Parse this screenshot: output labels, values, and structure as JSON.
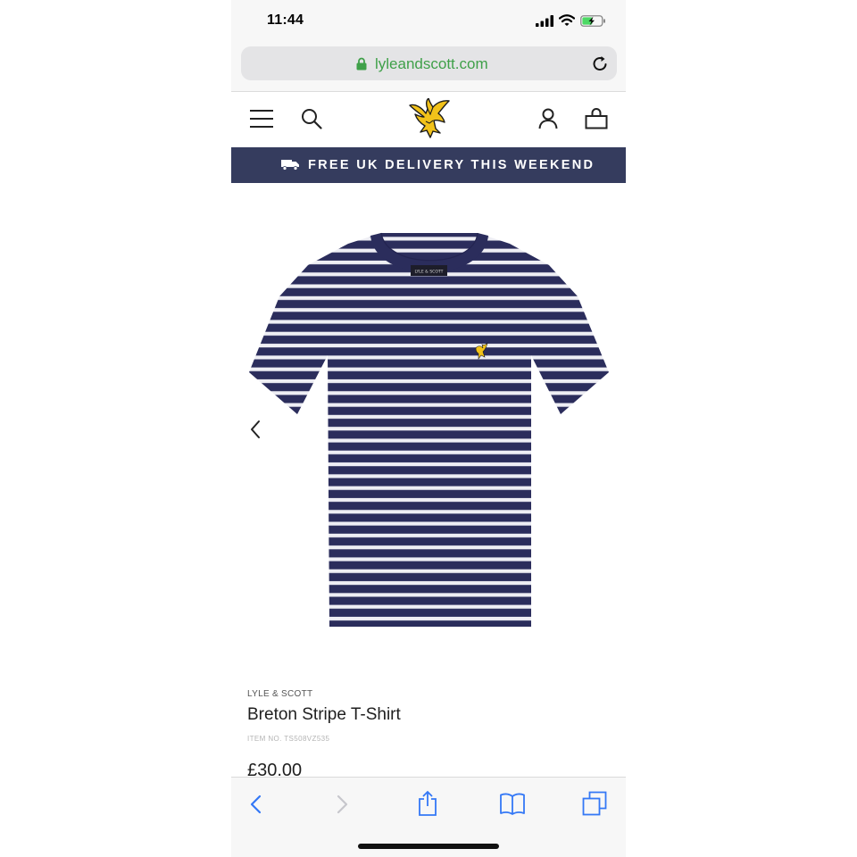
{
  "status_bar": {
    "time": "11:44"
  },
  "browser": {
    "url": "lyleandscott.com"
  },
  "header": {
    "icons": [
      "menu-icon",
      "search-icon",
      "golden-eagle-logo-icon",
      "account-icon",
      "bag-icon"
    ]
  },
  "banner": {
    "text": "FREE UK DELIVERY THIS WEEKEND",
    "icon": "truck-icon"
  },
  "product": {
    "label_text": "LYLE & SCOTT",
    "brand": "LYLE & SCOTT",
    "title": "Breton Stripe T-Shirt",
    "item_no": "ITEM NO. TS508VZ535",
    "price": "£30.00"
  },
  "toolbar": {
    "icons": [
      "back-icon",
      "forward-icon",
      "share-icon",
      "bookmarks-icon",
      "tabs-icon"
    ]
  },
  "colors": {
    "accent_green": "#3fa049",
    "banner_navy": "#353c5e",
    "shirt_navy": "#2b2d5c",
    "eagle_gold": "#f2c21a",
    "ios_blue": "#3478f6"
  }
}
